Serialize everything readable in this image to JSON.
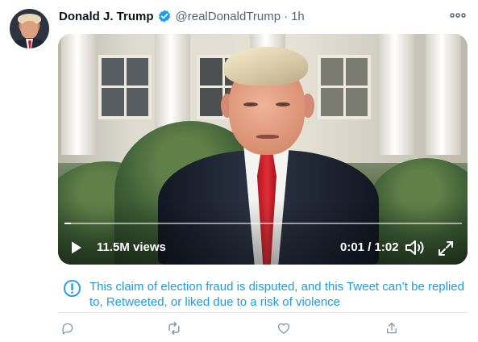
{
  "tweet": {
    "author": {
      "display_name": "Donald J. Trump",
      "handle": "@realDonaldTrump",
      "verified_icon": "verified-badge-icon",
      "avatar": "avatar"
    },
    "separator": "·",
    "timestamp": "1h",
    "more_icon": "more-options-icon"
  },
  "video": {
    "views": "11.5M views",
    "time": "0:01 / 1:02",
    "progress": 0.016,
    "play_icon": "play-icon",
    "volume_icon": "volume-icon",
    "fullscreen_icon": "fullscreen-icon"
  },
  "notice": {
    "text": "This claim of election fraud is disputed, and this Tweet can’t be replied to, Retweeted, or liked due to a risk of violence",
    "icon": "exclamation-circle-icon",
    "color": "#1d9bf0"
  },
  "actions": [
    {
      "icon": "reply-icon"
    },
    {
      "icon": "retweet-icon"
    },
    {
      "icon": "like-icon"
    },
    {
      "icon": "share-icon"
    }
  ],
  "colors": {
    "accent": "#1d9bf0",
    "text_primary": "#0f1419",
    "text_secondary": "#536471",
    "icon_muted": "#8b98a5"
  }
}
